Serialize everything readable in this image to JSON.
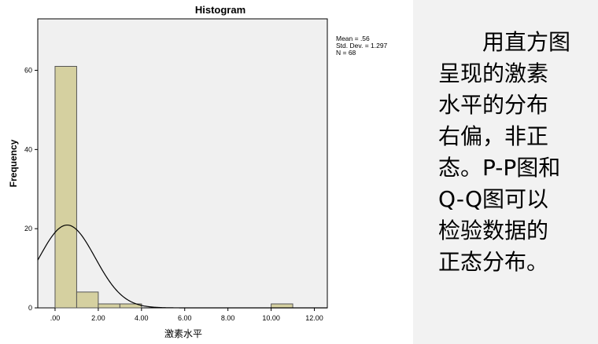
{
  "chart_data": {
    "type": "bar",
    "title": "Histogram",
    "xlabel": "激素水平",
    "ylabel": "Frequency",
    "bins": [
      {
        "start": 0,
        "end": 1,
        "count": 61
      },
      {
        "start": 1,
        "end": 2,
        "count": 4
      },
      {
        "start": 2,
        "end": 3,
        "count": 1
      },
      {
        "start": 3,
        "end": 4,
        "count": 1
      },
      {
        "start": 4,
        "end": 5,
        "count": 0
      },
      {
        "start": 5,
        "end": 6,
        "count": 0
      },
      {
        "start": 6,
        "end": 7,
        "count": 0
      },
      {
        "start": 7,
        "end": 8,
        "count": 0
      },
      {
        "start": 8,
        "end": 9,
        "count": 0
      },
      {
        "start": 9,
        "end": 10,
        "count": 0
      },
      {
        "start": 10,
        "end": 11,
        "count": 1
      }
    ],
    "x_ticks": [
      {
        "value": 0,
        "label": ".00"
      },
      {
        "value": 2,
        "label": "2.00"
      },
      {
        "value": 4,
        "label": "4.00"
      },
      {
        "value": 6,
        "label": "6.00"
      },
      {
        "value": 8,
        "label": "8.00"
      },
      {
        "value": 10,
        "label": "10.00"
      },
      {
        "value": 12,
        "label": "12.00"
      }
    ],
    "y_ticks": [
      {
        "value": 0,
        "label": "0"
      },
      {
        "value": 20,
        "label": "20"
      },
      {
        "value": 40,
        "label": "40"
      },
      {
        "value": 60,
        "label": "60"
      }
    ],
    "xlim": [
      -0.8,
      12.6
    ],
    "ylim": [
      0,
      73
    ],
    "grid": false,
    "normal_curve": {
      "mean": 0.56,
      "sd": 1.297,
      "n": 68,
      "bin_width": 1
    },
    "stats_box": {
      "mean": "Mean = .56",
      "std": "Std. Dev. = 1.297",
      "n": "N = 68"
    },
    "colors": {
      "bar_fill": "#d5d0a0",
      "bar_stroke": "#555555",
      "plot_background": "#f0f0f0",
      "curve": "#000000"
    }
  },
  "side_text": {
    "lines": [
      "　　用直方图",
      "呈现的激素",
      "水平的分布",
      "右偏，非正",
      "态。P-P图和",
      "Q-Q图可以",
      "检验数据的",
      "正态分布。"
    ]
  }
}
